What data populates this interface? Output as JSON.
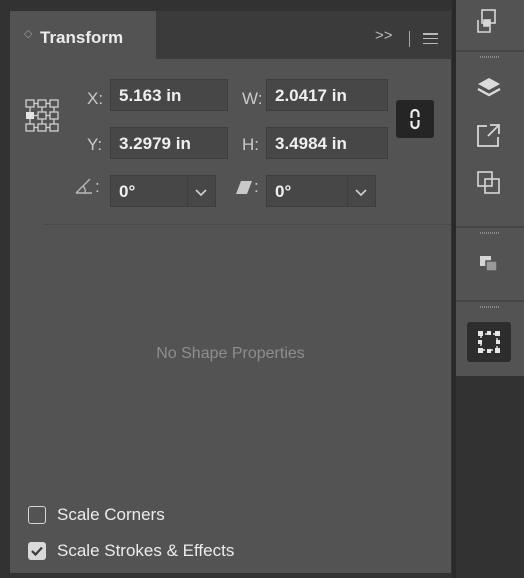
{
  "panel": {
    "tab_title": "Transform",
    "collapse_glyph": ">>",
    "x": {
      "label": "X:",
      "value": "5.163 in"
    },
    "y": {
      "label": "Y:",
      "value": "3.2979 in"
    },
    "w": {
      "label": "W:",
      "value": "2.0417 in"
    },
    "h": {
      "label": "H:",
      "value": "3.4984 in"
    },
    "rotate": {
      "suffix": ":",
      "value": "0°"
    },
    "shear": {
      "suffix": ":",
      "value": "0°"
    },
    "no_shape_text": "No Shape Properties",
    "scale_corners": {
      "label": "Scale Corners",
      "checked": false
    },
    "scale_strokes": {
      "label": "Scale Strokes & Effects",
      "checked": true
    }
  },
  "toolbar": {
    "icons": [
      "arrange-icon",
      "layers-icon",
      "export-icon",
      "pathfinder-icon",
      "align-icon",
      "transform-icon"
    ],
    "active": "transform-icon"
  }
}
